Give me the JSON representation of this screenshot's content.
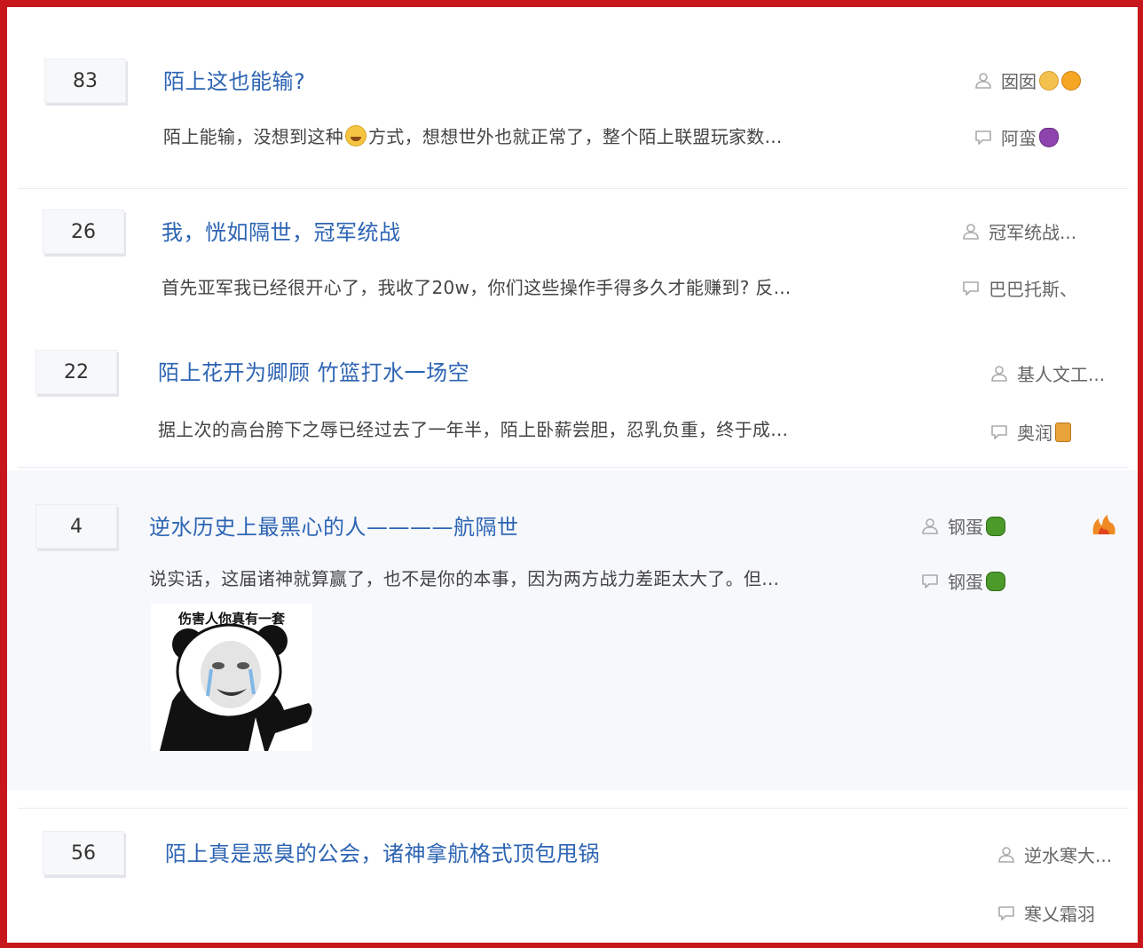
{
  "posts": [
    {
      "replies": "83",
      "title": "陌上这也能输?",
      "excerpt_a": "陌上能输，没想到这种",
      "excerpt_b": "方式，想想世外也就正常了，整个陌上联盟玩家数...",
      "author": "囡囡",
      "last_reply": "阿蛮"
    },
    {
      "replies": "26",
      "title": "我，恍如隔世，冠军统战",
      "excerpt": "首先亚军我已经很开心了，我收了20w，你们这些操作手得多久才能赚到? 反...",
      "author": "冠军统战...",
      "last_reply": "巴巴托斯、"
    },
    {
      "replies": "22",
      "title": "陌上花开为卿顾 竹篮打水一场空",
      "excerpt": "据上次的高台胯下之辱已经过去了一年半，陌上卧薪尝胆，忍乳负重，终于成...",
      "author": "基人文工...",
      "last_reply": "奥润"
    },
    {
      "replies": "4",
      "title": "逆水历史上最黑心的人————航隔世",
      "excerpt": "说实话，这届诸神就算赢了，也不是你的本事，因为两方战力差距太大了。但...",
      "author": "钢蛋",
      "last_reply": "钢蛋",
      "meme_caption": "伤害人你真有一套"
    },
    {
      "replies": "56",
      "title": "陌上真是恶臭的公会，诸神拿航格式顶包甩锅",
      "author": "逆水寒大...",
      "last_reply": "寒乂霜羽"
    }
  ],
  "icons": {
    "author": "user-icon",
    "last_reply": "comment-icon",
    "hot": "flame-icon"
  },
  "colors": {
    "frame": "#c8161d",
    "title_link": "#2d64b3",
    "highlight_bg": "#f6f8fc"
  }
}
